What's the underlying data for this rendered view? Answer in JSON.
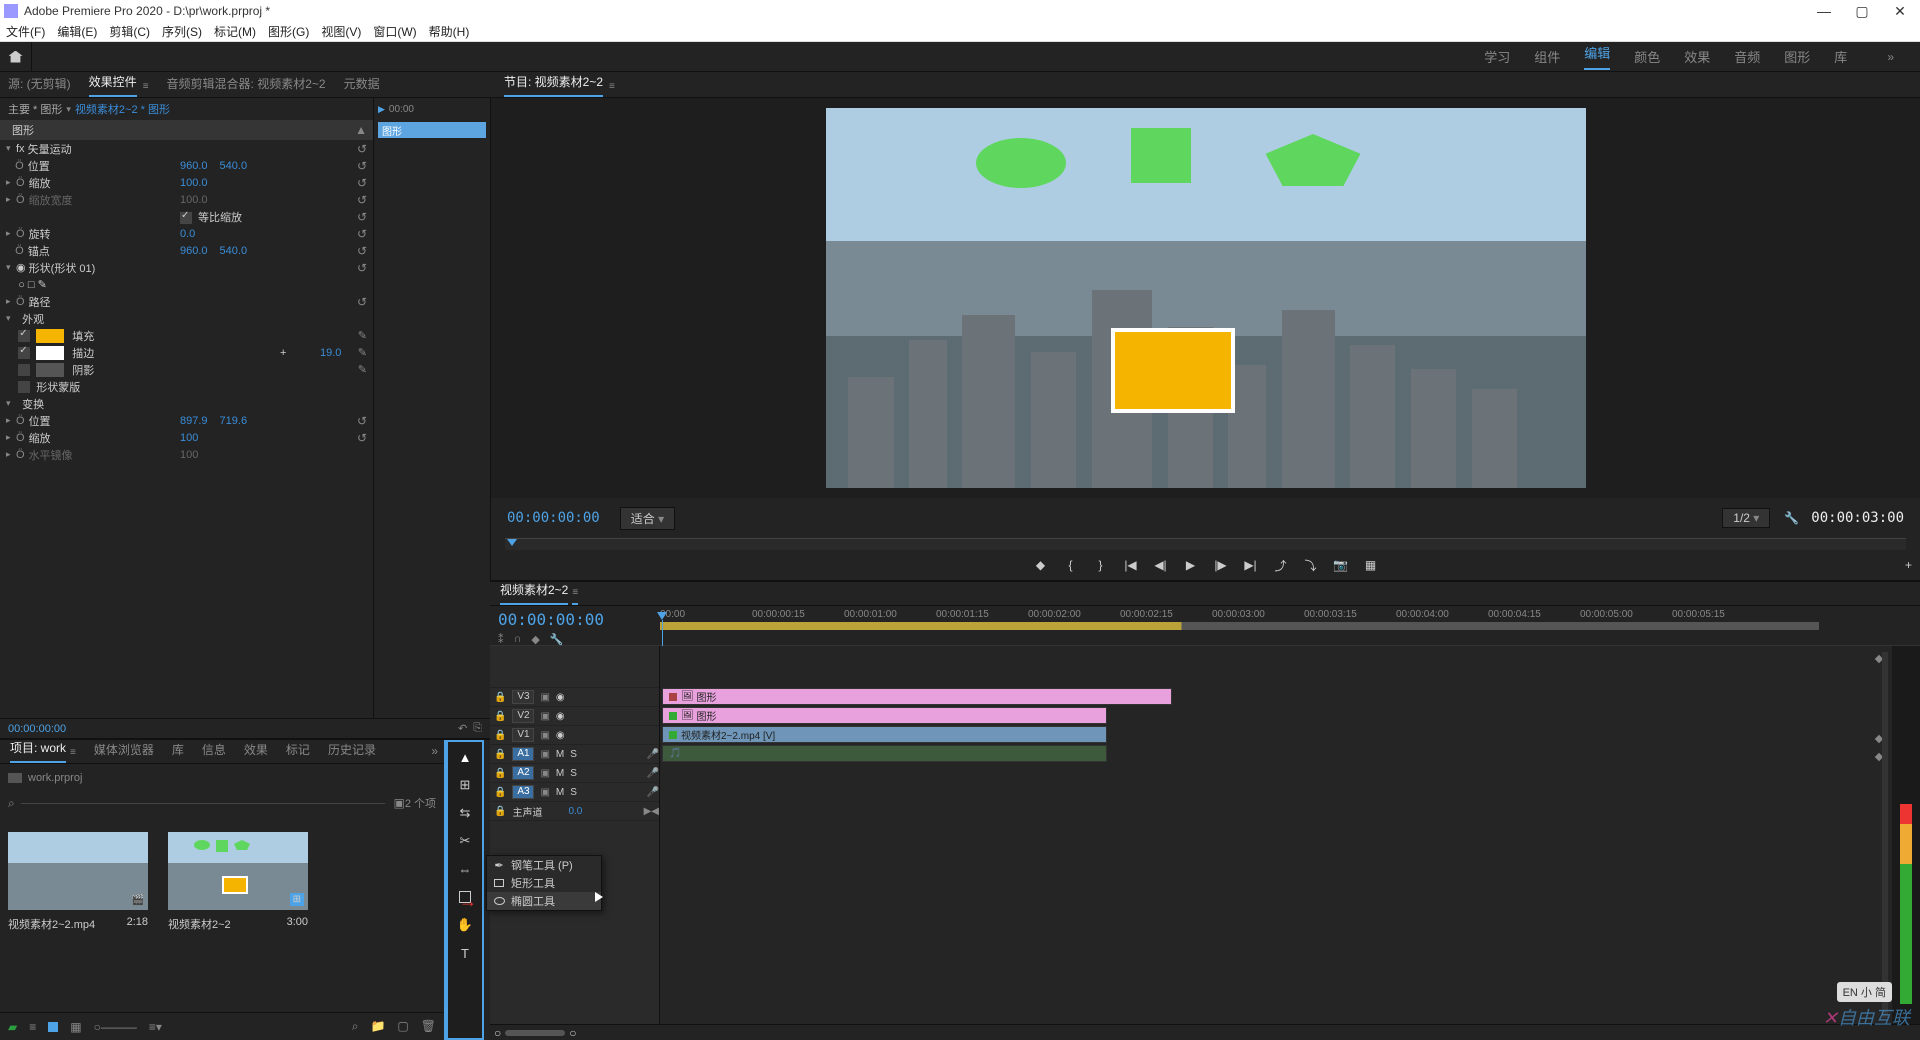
{
  "titlebar": {
    "title": "Adobe Premiere Pro 2020 - D:\\pr\\work.prproj *"
  },
  "menubar": [
    "文件(F)",
    "编辑(E)",
    "剪辑(C)",
    "序列(S)",
    "标记(M)",
    "图形(G)",
    "视图(V)",
    "窗口(W)",
    "帮助(H)"
  ],
  "workspaces": {
    "items": [
      "学习",
      "组件",
      "编辑",
      "颜色",
      "效果",
      "音频",
      "图形",
      "库"
    ],
    "active_index": 2
  },
  "source_tabs": {
    "items": [
      "源: (无剪辑)",
      "效果控件",
      "音频剪辑混合器: 视频素材2~2",
      "元数据"
    ],
    "active_index": 1
  },
  "ec": {
    "breadcrumb_main": "主要 * 图形",
    "breadcrumb_link": "视频素材2~2 * 图形",
    "section_graphic": "图形",
    "vector_motion": "矢量运动",
    "pos_label": "位置",
    "pos_x": "960.0",
    "pos_y": "540.0",
    "scale_label": "缩放",
    "scale_v": "100.0",
    "scalew_label": "缩放宽度",
    "scalew_v": "100.0",
    "uniform_label": "等比缩放",
    "rot_label": "旋转",
    "rot_v": "0.0",
    "anchor_label": "锚点",
    "anchor_x": "960.0",
    "anchor_y": "540.0",
    "shape_section": "形状(形状 01)",
    "path_label": "路径",
    "appearance_label": "外观",
    "fill_label": "填充",
    "fill_color": "#f4b400",
    "stroke_label": "描边",
    "stroke_color": "#ffffff",
    "stroke_w": "19.0",
    "shadow_label": "阴影",
    "mask_label": "形状蒙版",
    "transform_label": "变换",
    "t_pos_x": "897.9",
    "t_pos_y": "719.6",
    "t_scale_v": "100",
    "hrzmirror": "水平镜像",
    "hrz_v": "100",
    "timecode": "00:00:00:00",
    "tl_head": "00:00",
    "tl_clip": "图形"
  },
  "program": {
    "title": "节目: 视频素材2~2",
    "timecode": "00:00:00:00",
    "fit": "适合",
    "res": "1/2",
    "endtime": "00:00:03:00"
  },
  "project": {
    "tabs": [
      "项目: work",
      "媒体浏览器",
      "库",
      "信息",
      "效果",
      "标记",
      "历史记录"
    ],
    "active_index": 0,
    "bin": "work.prproj",
    "count": "2 个项",
    "thumb1_name": "视频素材2~2.mp4",
    "thumb1_dur": "2:18",
    "thumb2_name": "视频素材2~2",
    "thumb2_dur": "3:00"
  },
  "flyout": {
    "pen": "钢笔工具 (P)",
    "rect": "矩形工具",
    "ellipse": "椭圆工具"
  },
  "timeline": {
    "seq": "视频素材2~2",
    "timecode": "00:00:00:00",
    "ruler": [
      "00:00",
      "00:00:00:15",
      "00:00:01:00",
      "00:00:01:15",
      "00:00:02:00",
      "00:00:02:15",
      "00:00:03:00",
      "00:00:03:15",
      "00:00:04:00",
      "00:00:04:15",
      "00:00:05:00",
      "00:00:05:15"
    ],
    "v3": "V3",
    "v2": "V2",
    "v1": "V1",
    "a1": "A1",
    "a2": "A2",
    "a3": "A3",
    "master": "主声道",
    "master_v": "0.0",
    "m": "M",
    "s": "S",
    "clip_v3": "图形",
    "clip_v2": "图形",
    "clip_v1": "视频素材2~2.mp4 [V]"
  },
  "watermark": "自由互联",
  "ime": "EN 小 简"
}
